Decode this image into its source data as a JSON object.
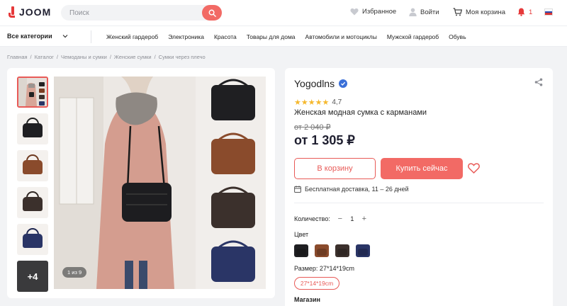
{
  "header": {
    "logo_text": "JOOM",
    "search_placeholder": "Поиск",
    "favorites": "Избранное",
    "login": "Войти",
    "cart": "Моя корзина",
    "notifications_count": "1"
  },
  "nav": {
    "all_categories": "Все категории",
    "items": [
      "Женский гардероб",
      "Электроника",
      "Красота",
      "Товары для дома",
      "Автомобили и мотоциклы",
      "Мужской гардероб",
      "Обувь"
    ]
  },
  "breadcrumbs": [
    "Главная",
    "Каталог",
    "Чемоданы и сумки",
    "Женские сумки",
    "Сумки через плечо"
  ],
  "gallery": {
    "more_label": "+4",
    "counter": "1 из 9"
  },
  "product": {
    "seller": "Yogodlns",
    "rating": "4,7",
    "stars": "★★★★★",
    "name": "Женская модная сумка с карманами",
    "old_price": "от 2 040 ₽",
    "price": "от 1 305 ₽",
    "add_to_cart": "В корзину",
    "buy_now": "Купить сейчас",
    "delivery": "Бесплатная доставка, 11 – 26 дней",
    "quantity_label": "Количество:",
    "quantity": "1",
    "qty_minus": "−",
    "qty_plus": "+",
    "color_label": "Цвет",
    "size_label": "Размер: 27*14*19cm",
    "size_option": "27*14*19cm",
    "store_label": "Магазин"
  },
  "colors": {
    "accent": "#f26a65",
    "swatches": [
      "#1f1f22",
      "#8a4b2c",
      "#3b302c",
      "#2a3566"
    ]
  }
}
